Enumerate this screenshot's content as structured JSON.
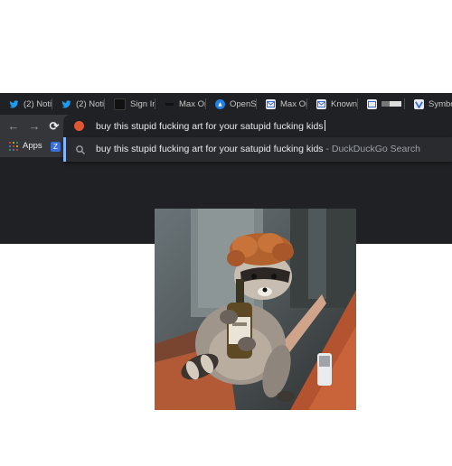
{
  "tabs": [
    {
      "title": "(2) Noti",
      "icon": "twitter-icon",
      "color": "#1d9bf0"
    },
    {
      "title": "(2) Noti",
      "icon": "twitter-icon",
      "color": "#1d9bf0"
    },
    {
      "title": "Sign In",
      "icon": "square-icon",
      "color": "#111111"
    },
    {
      "title": "Max Or",
      "icon": "dash-icon",
      "color": "#111111"
    },
    {
      "title": "OpenSe",
      "icon": "opensea-icon",
      "color": "#2081e2"
    },
    {
      "title": "Max Or",
      "icon": "mail-icon",
      "color": "#ffffff"
    },
    {
      "title": "Known",
      "icon": "mail-icon",
      "color": "#ffffff"
    },
    {
      "title": "",
      "icon": "bar-icon",
      "color": "#cccccc"
    },
    {
      "title": "Symbo",
      "icon": "check-icon",
      "color": "#6b9fff"
    }
  ],
  "toolbar": {
    "back": "←",
    "forward": "→",
    "reload": "⟳",
    "address": "buy this stupid fucking art for your satupid fucking kids"
  },
  "bookmarks": {
    "apps_label": "Apps"
  },
  "suggestion": {
    "text": "buy this stupid fucking art for your satupid fucking kids",
    "source": " - DuckDuckGo Search"
  },
  "colors": {
    "frame": "#202124",
    "toolbar": "#35363a",
    "accent": "#8ab4f8",
    "duckduckgo": "#de5833"
  }
}
